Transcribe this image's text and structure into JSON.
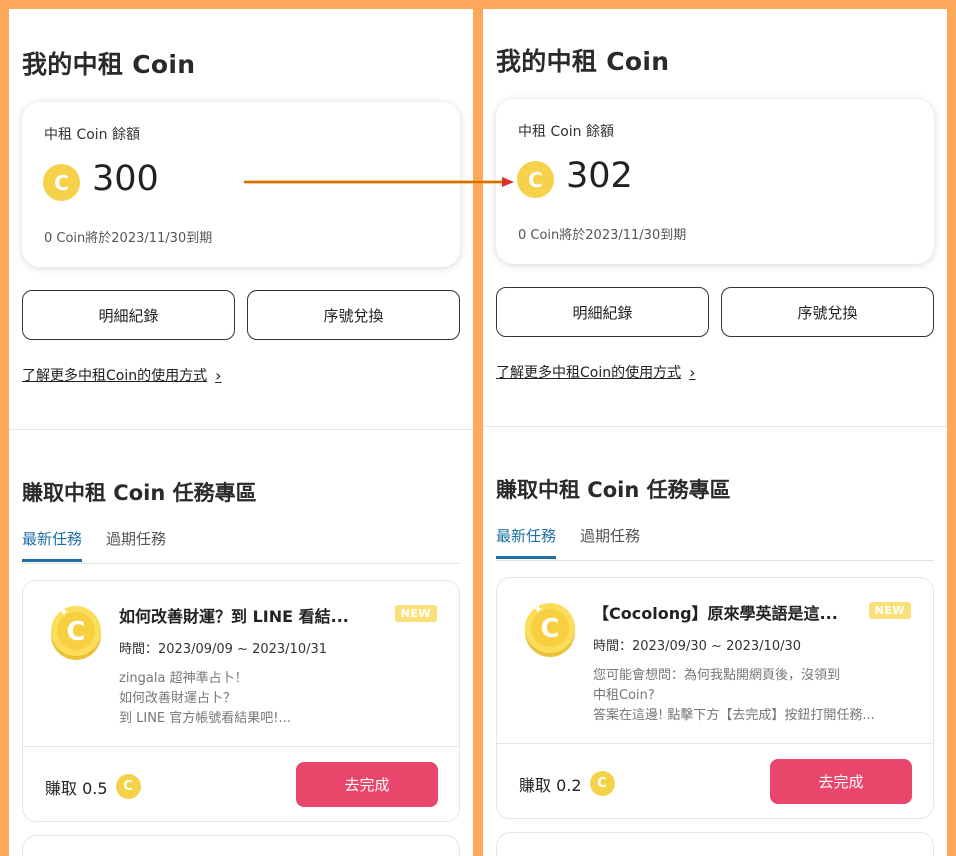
{
  "panels": [
    {
      "title": "我的中租 Coin",
      "balance_label": "中租 Coin 餘額",
      "coin_glyph": "C",
      "balance": "300",
      "expire_note": "0 Coin將於2023/11/30到期",
      "btn_history": "明細紀錄",
      "btn_redeem": "序號兌換",
      "learn_more": "了解更多中租Coin的使用方式",
      "section_title": "賺取中租 Coin 任務專區",
      "tab_active": "最新任務",
      "tab_other": "過期任務",
      "task": {
        "title": "如何改善財運？到 LINE 看結...",
        "badge": "NEW",
        "time": "時間：2023/09/09 ~ 2023/10/31",
        "desc": [
          " zingala 超神準占卜！",
          "如何改善財運占卜？",
          "到 LINE 官方帳號看結果吧!..."
        ],
        "earn": "賺取 0.5",
        "button": "去完成"
      }
    },
    {
      "title": "我的中租 Coin",
      "balance_label": "中租 Coin 餘額",
      "coin_glyph": "C",
      "balance": "302",
      "expire_note": "0 Coin將於2023/11/30到期",
      "btn_history": "明細紀錄",
      "btn_redeem": "序號兌換",
      "learn_more": "了解更多中租Coin的使用方式",
      "section_title": "賺取中租 Coin 任務專區",
      "tab_active": "最新任務",
      "tab_other": "過期任務",
      "task": {
        "title": "【Cocolong】原來學英語是這...",
        "badge": "NEW",
        "time": "時間：2023/09/30 ~ 2023/10/30",
        "desc": [
          "您可能會想問：為何我點開網頁後，沒領到",
          "中租Coin?",
          "答案在這邊! 點擊下方【去完成】按鈕打開任務..."
        ],
        "earn": "賺取 0.2",
        "button": "去完成"
      }
    }
  ],
  "colors": {
    "frame": "#fda85a",
    "coin": "#f6d24a",
    "accent_tab": "#1f6fa3",
    "cta": "#e8466b",
    "badge": "#fbe07a"
  }
}
